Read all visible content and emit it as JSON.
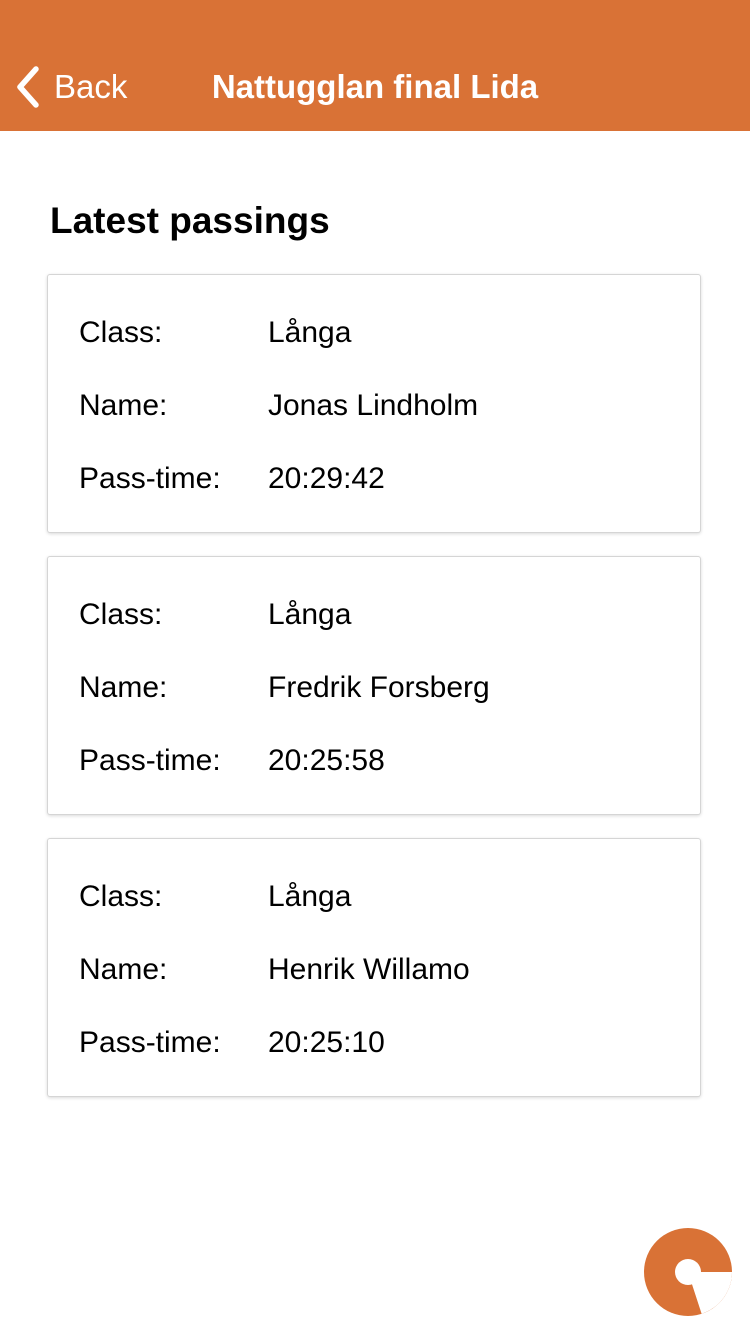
{
  "navbar": {
    "back_label": "Back",
    "title": "Nattugglan final Lida",
    "background_color": "#d97236",
    "back_icon": "chevron-left-icon"
  },
  "section_title": "Latest passings",
  "labels": {
    "class": "Class:",
    "name": "Name:",
    "pass_time": "Pass-time:"
  },
  "passings": [
    {
      "class": "Långa",
      "name": "Jonas Lindholm",
      "pass_time": "20:29:42"
    },
    {
      "class": "Långa",
      "name": "Fredrik Forsberg",
      "pass_time": "20:25:58"
    },
    {
      "class": "Långa",
      "name": "Henrik Willamo",
      "pass_time": "20:25:10"
    }
  ],
  "fab": {
    "icon": "app-logo-icon",
    "color": "#d97236"
  }
}
